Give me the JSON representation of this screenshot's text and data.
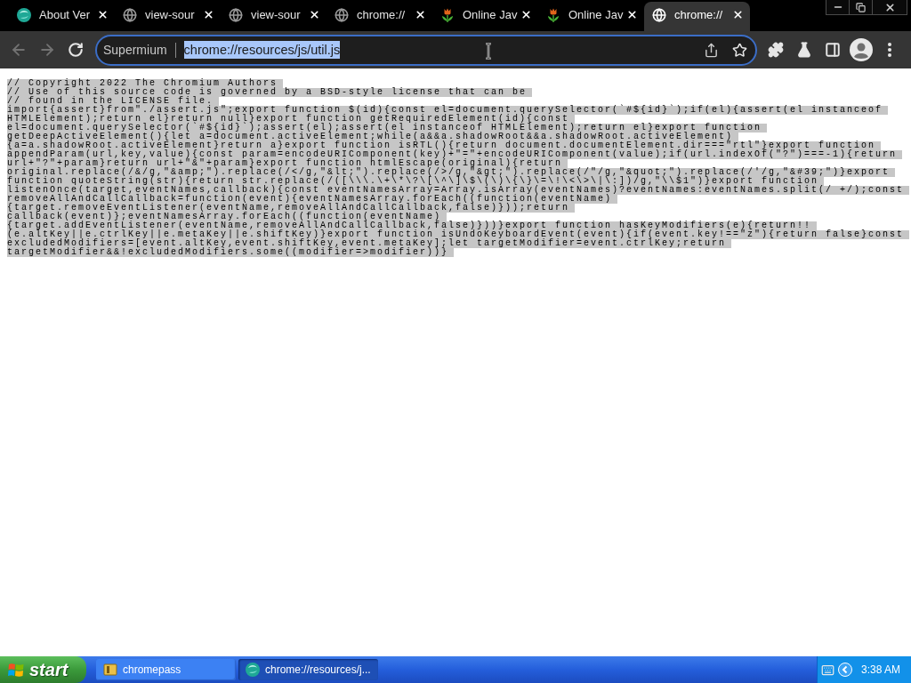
{
  "tabs": [
    {
      "title": "About Ver",
      "kind": "app",
      "selected": false
    },
    {
      "title": "view-sour",
      "kind": "globe",
      "selected": false
    },
    {
      "title": "view-sour",
      "kind": "globe",
      "selected": false
    },
    {
      "title": "chrome://",
      "kind": "globe",
      "selected": false
    },
    {
      "title": "Online Jav",
      "kind": "flower",
      "selected": false
    },
    {
      "title": "Online Jav",
      "kind": "flower",
      "selected": false
    },
    {
      "title": "chrome://",
      "kind": "globe",
      "selected": true
    }
  ],
  "toolbar": {
    "nav": [
      {
        "kind": "back",
        "disabled": true
      },
      {
        "kind": "forward",
        "disabled": true
      },
      {
        "kind": "reload",
        "disabled": false
      }
    ],
    "omnibox": {
      "chip": "Supermium",
      "value": "chrome://resources/js/util.js",
      "selected": true
    }
  },
  "page": {
    "selected": true,
    "lines": [
      "// Copyright 2022 The Chromium Authors",
      "// Use of this source code is governed by a BSD-style license that can be",
      "// found in the LICENSE file.",
      "import{assert}from\"./assert.js\";export function $(id){const el=document.querySelector(`#${id}`);if(el){assert(el instanceof",
      "HTMLElement);return el}return null}export function getRequiredElement(id){const",
      "el=document.querySelector(`#${id}`);assert(el);assert(el instanceof HTMLElement);return el}export function",
      "getDeepActiveElement(){let a=document.activeElement;while(a&&a.shadowRoot&&a.shadowRoot.activeElement)",
      "{a=a.shadowRoot.activeElement}return a}export function isRTL(){return document.documentElement.dir===\"rtl\"}export function",
      "appendParam(url,key,value){const param=encodeURIComponent(key)+\"=\"+encodeURIComponent(value);if(url.indexOf(\"?\")===-1){return",
      "url+\"?\"+param}return url+\"&\"+param}export function htmlEscape(original){return",
      "original.replace(/&/g,\"&amp;\").replace(/</g,\"&lt;\").replace(/>/g,\"&gt;\").replace(/\"/g,\"&quot;\").replace(/'/g,\"&#39;\")}export",
      "function quoteString(str){return str.replace(/([\\\\\\.\\+\\*\\?\\[\\^\\]\\$\\(\\)\\{\\}\\=\\!\\<\\>\\|\\:])/g,\"\\\\$1\")}export function",
      "listenOnce(target,eventNames,callback){const eventNamesArray=Array.isArray(eventNames)?eventNames:eventNames.split(/ +/);const",
      "removeAllAndCallCallback=function(event){eventNamesArray.forEach((function(eventName)",
      "{target.removeEventListener(eventName,removeAllAndCallCallback,false)}));return",
      "callback(event)};eventNamesArray.forEach((function(eventName)",
      "{target.addEventListener(eventName,removeAllAndCallCallback,false)}))}export function hasKeyModifiers(e){return!!",
      "(e.altKey||e.ctrlKey||e.metaKey||e.shiftKey)}export function isUndoKeyboardEvent(event){if(event.key!==\"z\"){return false}const",
      "excludedModifiers=[event.altKey,event.shiftKey,event.metaKey];let targetModifier=event.ctrlKey;return",
      "targetModifier&&!excludedModifiers.some((modifier=>modifier))}"
    ]
  },
  "taskbar": {
    "start": "start",
    "buttons": [
      {
        "label": "chromepass",
        "kind": "folder",
        "selected": false
      },
      {
        "label": "chrome://resources/j...",
        "kind": "app",
        "selected": true
      }
    ],
    "clock": "3:38 AM"
  }
}
